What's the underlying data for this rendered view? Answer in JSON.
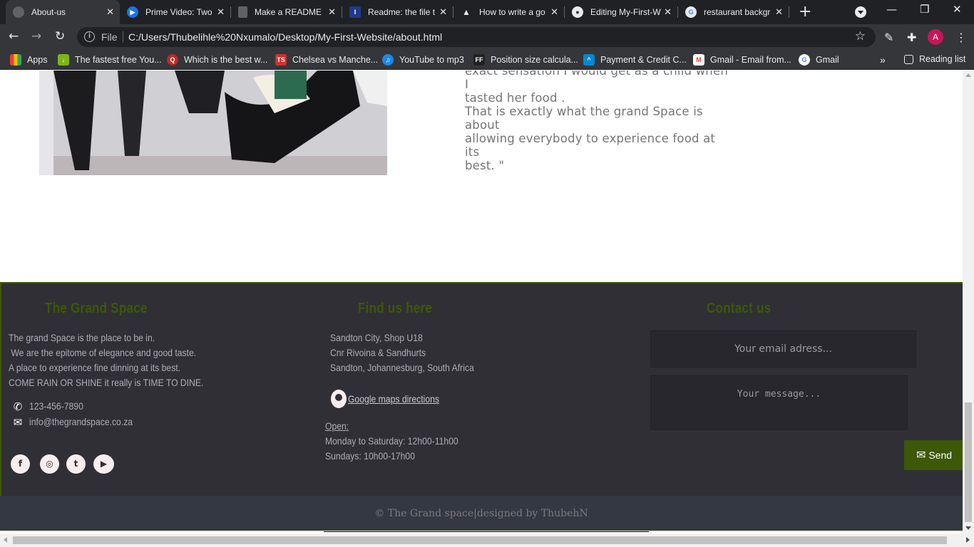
{
  "browser": {
    "tabs": [
      {
        "title": "About-us",
        "favicon": "globe-icon",
        "color": "#5f6368"
      },
      {
        "title": "Prime Video: Two",
        "favicon": "prime-video-icon",
        "color": "#1a73e8"
      },
      {
        "title": "Make a README",
        "favicon": "document-icon",
        "color": "#5f6368"
      },
      {
        "title": "Readme: the file t",
        "favicon": "readme-icon",
        "color": "#1e3a8a"
      },
      {
        "title": "How to write a go",
        "favicon": "cat-icon",
        "color": "#202124"
      },
      {
        "title": "Editing My-First-W",
        "favicon": "github-icon",
        "color": "#e8eaed"
      },
      {
        "title": "restaurant backgr",
        "favicon": "google-icon",
        "color": "#e8eaed"
      }
    ],
    "address": {
      "scheme": "File",
      "url": "C:/Users/Thubelihle%20Nxumalo/Desktop/My-First-Website/about.html"
    },
    "profile_initial": "A",
    "bookmarks": [
      {
        "label": "Apps",
        "icon": "apps-grid-icon"
      },
      {
        "label": "The fastest free You...",
        "icon": "download-arrow-icon"
      },
      {
        "label": "Which is the best w...",
        "icon": "quora-icon"
      },
      {
        "label": "Chelsea vs Manche...",
        "icon": "ts-icon"
      },
      {
        "label": "YouTube to mp3",
        "icon": "headphones-icon"
      },
      {
        "label": "Position size calcula...",
        "icon": "ff-icon"
      },
      {
        "label": "Payment & Credit C...",
        "icon": "payment-icon"
      },
      {
        "label": "Gmail - Email from...",
        "icon": "gmail-icon"
      },
      {
        "label": "Gmail",
        "icon": "google-icon"
      }
    ],
    "reading_list": "Reading list"
  },
  "about": {
    "quote_lines": [
      "exact sensation I would get as a child when I",
      "tasted her food .",
      "That is exactly what the grand Space is about",
      "allowing everybody to experience food at its",
      "best. \""
    ]
  },
  "footer": {
    "brand": {
      "heading": "The Grand  Space",
      "lines": [
        "The grand Space is the place to be in.",
        " We are the epitome of elegance and good taste.",
        "A place to experience fine dinning at its best.",
        "COME RAIN OR SHINE it really is TIME TO DINE."
      ],
      "phone": "123-456-7890",
      "email": "info@thegrandspace.co.za"
    },
    "location": {
      "heading": "Find us here",
      "address": [
        "Sandton City, Shop U18",
        "Cnr Rivoina & Sandhurts",
        "Sandton, Johannesburg, South Africa"
      ],
      "maps_link": "Google maps directions",
      "open_label": "Open:",
      "hours": [
        "Monday to Saturday: 12h00-11h00",
        "Sundays: 10h00-17h00"
      ]
    },
    "contact": {
      "heading": "Contact us",
      "email_placeholder": "Your email adress...",
      "message_placeholder": "Your message...",
      "send_label": "Send"
    },
    "copyright": "© The Grand space|designed by ThubehN"
  }
}
